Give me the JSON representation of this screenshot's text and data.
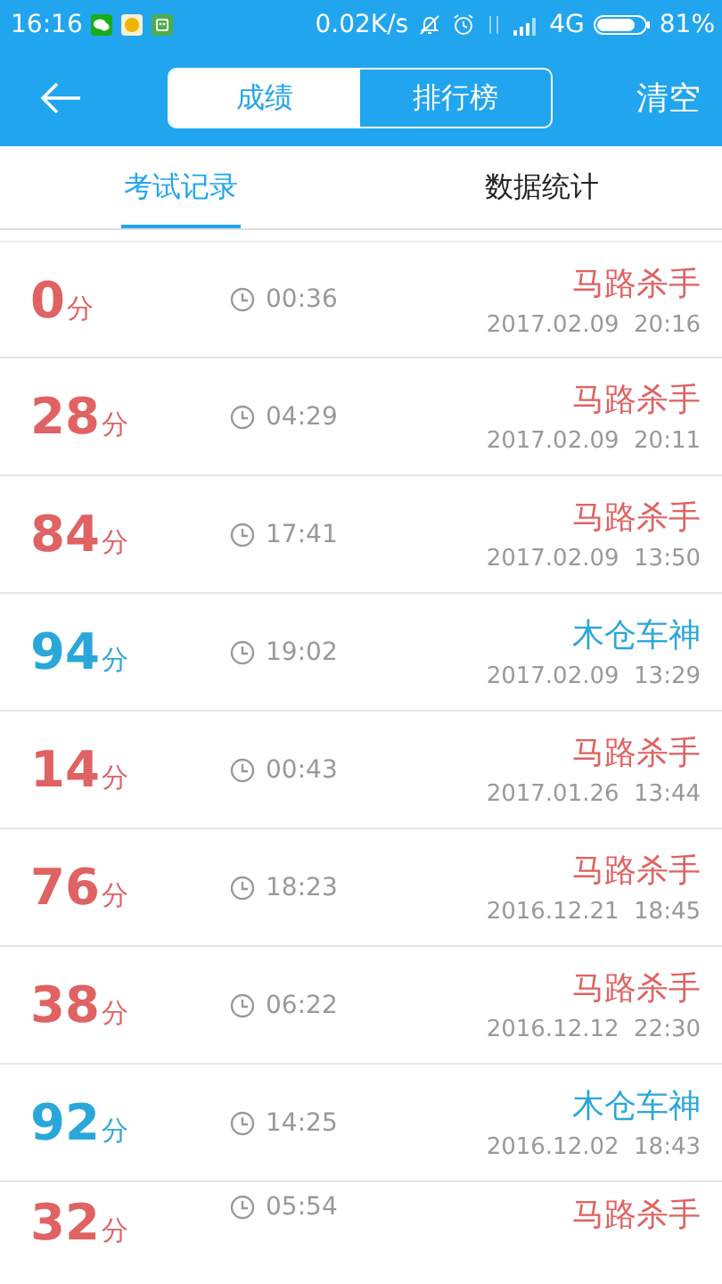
{
  "status_bar": {
    "time": "16:16",
    "speed": "0.02K/s",
    "network": "4G",
    "battery": "81%"
  },
  "header": {
    "segments": [
      {
        "label": "成绩",
        "selected": true
      },
      {
        "label": "排行榜",
        "selected": false
      }
    ],
    "action": "清空"
  },
  "tabs": [
    {
      "label": "考试记录",
      "selected": true
    },
    {
      "label": "数据统计",
      "selected": false
    }
  ],
  "records": [
    {
      "score": "0",
      "unit": "分",
      "duration": "00:36",
      "title": "马路杀手",
      "date": "2017.02.09  20:16",
      "color": "#e06262"
    },
    {
      "score": "28",
      "unit": "分",
      "duration": "04:29",
      "title": "马路杀手",
      "date": "2017.02.09  20:11",
      "color": "#e06262"
    },
    {
      "score": "84",
      "unit": "分",
      "duration": "17:41",
      "title": "马路杀手",
      "date": "2017.02.09  13:50",
      "color": "#e06262"
    },
    {
      "score": "94",
      "unit": "分",
      "duration": "19:02",
      "title": "木仓车神",
      "date": "2017.02.09  13:29",
      "color": "#2aa7d9"
    },
    {
      "score": "14",
      "unit": "分",
      "duration": "00:43",
      "title": "马路杀手",
      "date": "2017.01.26  13:44",
      "color": "#e06262"
    },
    {
      "score": "76",
      "unit": "分",
      "duration": "18:23",
      "title": "马路杀手",
      "date": "2016.12.21  18:45",
      "color": "#e06262"
    },
    {
      "score": "38",
      "unit": "分",
      "duration": "06:22",
      "title": "马路杀手",
      "date": "2016.12.12  22:30",
      "color": "#e06262"
    },
    {
      "score": "92",
      "unit": "分",
      "duration": "14:25",
      "title": "木仓车神",
      "date": "2016.12.02  18:43",
      "color": "#2aa7d9"
    },
    {
      "score": "32",
      "unit": "分",
      "duration": "05:54",
      "title": "马路杀手",
      "color": "#e06262"
    }
  ]
}
